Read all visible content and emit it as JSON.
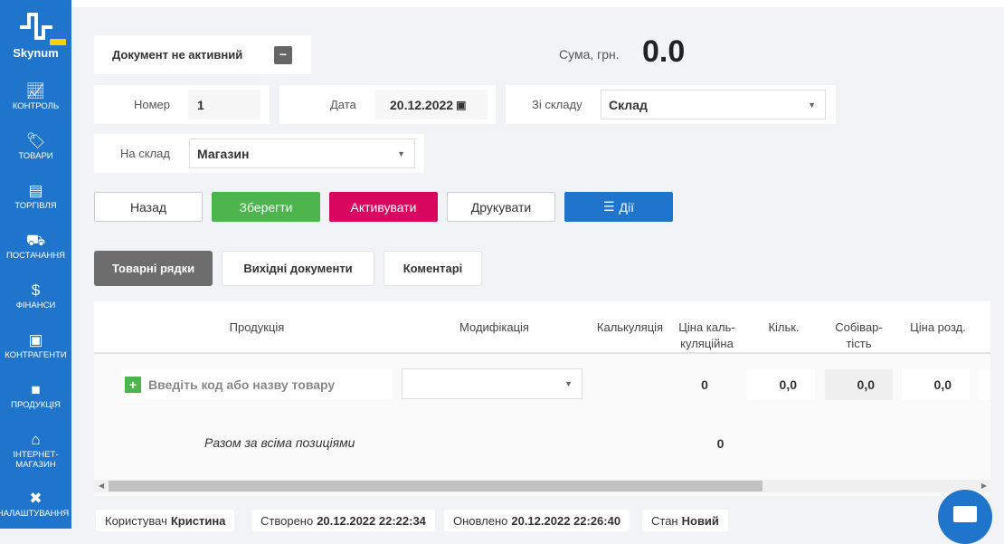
{
  "sidebar": {
    "brand": "Skynum",
    "items": [
      {
        "label": "КОНТРОЛЬ",
        "icon": "chart-icon"
      },
      {
        "label": "ТОВАРИ",
        "icon": "tags-icon"
      },
      {
        "label": "ТОРГІВЛЯ",
        "icon": "cash-register-icon"
      },
      {
        "label": "ПОСТАЧАННЯ",
        "icon": "truck-icon"
      },
      {
        "label": "ФІНАНСИ",
        "icon": "hand-dollar-icon"
      },
      {
        "label": "КОНТРАГЕНТИ",
        "icon": "id-card-icon"
      },
      {
        "label": "ПРОДУКЦІЯ",
        "icon": "box-icon"
      },
      {
        "label": "ІНТЕРНЕТ-МАГАЗИН",
        "icon": "basket-icon"
      },
      {
        "label": "НАЛАШТУВАННЯ",
        "icon": "tools-icon"
      }
    ]
  },
  "header": {
    "status": "Документ не активний",
    "sum_label": "Сума, грн.",
    "sum_value": "0.0"
  },
  "form": {
    "number_label": "Номер",
    "number_value": "1",
    "date_label": "Дата",
    "date_value": "20.12.2022",
    "from_label": "Зі складу",
    "from_value": "Склад",
    "to_label": "На склад",
    "to_value": "Магазин"
  },
  "actions": {
    "back": "Назад",
    "save": "Зберегти",
    "activate": "Активувати",
    "print": "Друкувати",
    "more": "Дії"
  },
  "tabs": [
    "Товарні рядки",
    "Вихідні документи",
    "Коментарі"
  ],
  "table": {
    "headers": [
      "Продукція",
      "Модифікація",
      "Калькуляція",
      "Ціна каль-куляційна",
      "Кільк.",
      "Собівар-тість",
      "Ціна розд."
    ],
    "input_placeholder": "Введіть код або назву товару",
    "row": {
      "calc_price": "0",
      "qty": "0,0",
      "cost": "0,0",
      "retail": "0,0"
    },
    "total_label": "Разом за всіма позиціями",
    "total_value": "0"
  },
  "footer": {
    "user_label": "Користувач",
    "user": "Кристина",
    "created_label": "Створено",
    "created": "20.12.2022 22:22:34",
    "updated_label": "Оновлено",
    "updated": "20.12.2022 22:26:40",
    "state_label": "Стан",
    "state": "Новий"
  }
}
